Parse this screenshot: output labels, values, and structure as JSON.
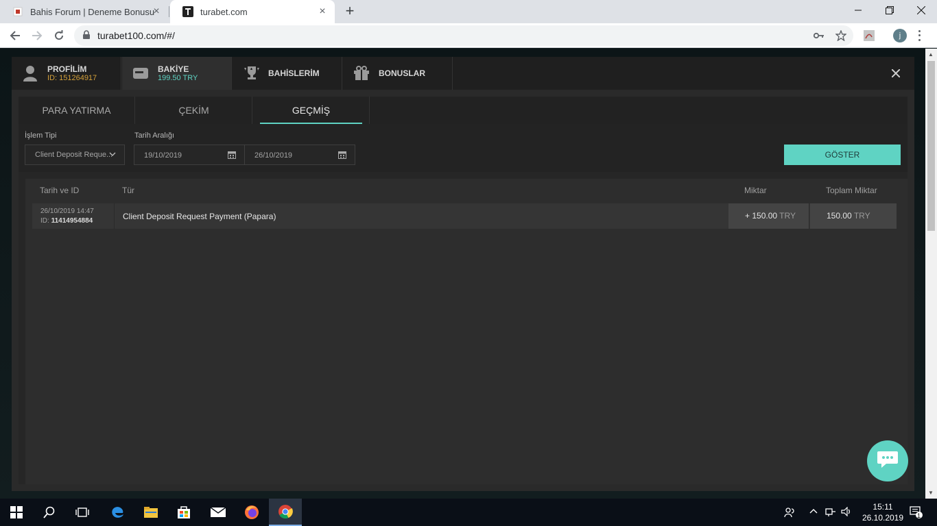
{
  "browser": {
    "tabs": [
      {
        "title": "Bahis Forum | Deneme Bonusu",
        "active": false
      },
      {
        "title": "turabet.com",
        "active": true
      }
    ],
    "url": "turabet100.com/#/",
    "profile_initial": "j"
  },
  "modal": {
    "nav": [
      {
        "title": "PROFİLİM",
        "sub": "ID: 151264917",
        "icon": "user-icon"
      },
      {
        "title": "BAKİYE",
        "sub": "199.50 TRY",
        "icon": "wallet-icon"
      },
      {
        "title": "BAHİSLERİM",
        "icon": "trophy-icon"
      },
      {
        "title": "BONUSLAR",
        "icon": "gift-icon"
      }
    ],
    "subtabs": [
      "PARA YATIRMA",
      "ÇEKİM",
      "GEÇMİŞ"
    ],
    "active_subtab": "GEÇMİŞ",
    "filters": {
      "type_label": "İşlem Tipi",
      "type_value": "Client Deposit Reque...",
      "range_label": "Tarih Aralığı",
      "date_from": "19/10/2019",
      "date_to": "26/10/2019",
      "show_button": "GÖSTER"
    },
    "table": {
      "headers": [
        "Tarih ve ID",
        "Tür",
        "Miktar",
        "Toplam Miktar"
      ],
      "rows": [
        {
          "datetime": "26/10/2019 14:47",
          "id_prefix": "ID:",
          "id": "11414954884",
          "type": "Client Deposit Request Payment (Papara)",
          "amount": "+ 150.00",
          "amount_currency": "TRY",
          "total": "150.00",
          "total_currency": "TRY"
        }
      ]
    }
  },
  "taskbar": {
    "time": "15:11",
    "date": "26.10.2019",
    "notification_count": "1"
  },
  "colors": {
    "accent": "#5fd3c3",
    "id_orange": "#d4a13a",
    "modal_bg": "#2a2a2a"
  }
}
